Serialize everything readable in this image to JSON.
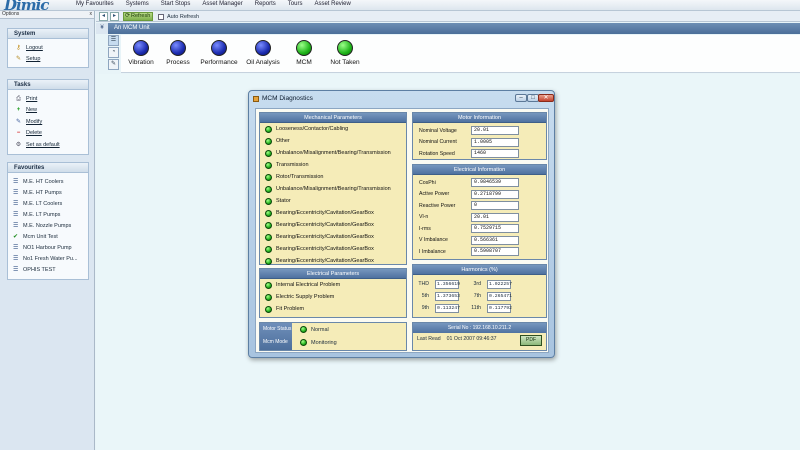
{
  "app": {
    "logo_text": "Dimic"
  },
  "menu": [
    "My Favourites",
    "Systems",
    "Start Stops",
    "Asset Manager",
    "Reports",
    "Tours",
    "Asset Review"
  ],
  "left_panel": {
    "options_label": "Options",
    "close_glyph": "x",
    "system": {
      "title": "System",
      "items": [
        {
          "label": "Logout",
          "icon": "key-icon"
        },
        {
          "label": "Setup",
          "icon": "wrench-icon"
        }
      ]
    },
    "tasks": {
      "title": "Tasks",
      "items": [
        {
          "label": "Print",
          "icon": "printer-icon"
        },
        {
          "label": "New",
          "icon": "plus-icon"
        },
        {
          "label": "Modify",
          "icon": "pencil-icon"
        },
        {
          "label": "Delete",
          "icon": "delete-icon"
        },
        {
          "label": "Set as default",
          "icon": "settings-icon"
        }
      ]
    },
    "favourites": {
      "title": "Favourites",
      "items": [
        "M.E. HT Coolers",
        "M.E. HT Pumps",
        "M.E. LT Coolers",
        "M.E. LT Pumps",
        "M.E. Nozzle Pumps",
        "Mcm Unit Test",
        "NO1 Harbour Pump",
        "No1 Fresh Water Pu...",
        "OPHIS TEST"
      ]
    }
  },
  "toolbar": {
    "refresh_label": "Refresh",
    "auto_refresh_label": "Auto Refresh",
    "auto_refresh_checked": false
  },
  "unit": {
    "title": "An MCM Unit",
    "collapse_glyph": "¥"
  },
  "status_indicators": [
    {
      "label": "Vibration",
      "color": "blue"
    },
    {
      "label": "Process",
      "color": "blue"
    },
    {
      "label": "Performance",
      "color": "blue"
    },
    {
      "label": "Oil Analysis",
      "color": "blue"
    },
    {
      "label": "MCM",
      "color": "green"
    },
    {
      "label": "Not Taken",
      "color": "green"
    }
  ],
  "dialog": {
    "title": "MCM Diagnostics",
    "mechanical": {
      "title": "Mechanical Parameters",
      "items": [
        "Looseness/Contactor/Cabling",
        "Other",
        "Unbalance/Misalignment/Bearing/Transmission",
        "Transmission",
        "Rotor/Transmission",
        "Unbalance/Misalignment/Bearing/Transmission",
        "Stator",
        "Bearing/Eccentricity/Cavitation/GearBox",
        "Bearing/Eccentricity/Cavitation/GearBox",
        "Bearing/Eccentricity/Cavitation/GearBox",
        "Bearing/Eccentricity/Cavitation/GearBox",
        "Bearing/Eccentricity/Cavitation/GearBox"
      ]
    },
    "electrical_params": {
      "title": "Electrical Parameters",
      "items": [
        "Internal Electrical Problem",
        "Electric Supply Problem",
        "Fit Problem"
      ]
    },
    "motor_info": {
      "title": "Motor Information",
      "rows": [
        {
          "label": "Nominal Voltage",
          "value": "20.01"
        },
        {
          "label": "Nominal Current",
          "value": "1.0005"
        },
        {
          "label": "Rotation Speed",
          "value": "1460"
        }
      ]
    },
    "electrical_info": {
      "title": "Electrical Information",
      "rows": [
        {
          "label": "CosPhi",
          "value": "0.9846539"
        },
        {
          "label": "Active Power",
          "value": "0.2718799"
        },
        {
          "label": "Reactive Power",
          "value": "0"
        },
        {
          "label": "Vl-n",
          "value": "20.01"
        },
        {
          "label": "I-rms",
          "value": "0.7529715"
        },
        {
          "label": "V Imbalance",
          "value": "0.566361"
        },
        {
          "label": "I Imbalance",
          "value": "0.5908707"
        }
      ]
    },
    "harmonics": {
      "title": "Harmonics (%)",
      "rows": [
        {
          "k1": "THD",
          "v1": "1.356619",
          "k2": "3rd",
          "v2": "1.022257"
        },
        {
          "k1": "5th",
          "v1": "1.373653",
          "k2": "7th",
          "v2": "0.265471"
        },
        {
          "k1": "9th",
          "v1": "0.113247",
          "k2": "11th",
          "v2": "0.117792"
        }
      ]
    },
    "motor_status": {
      "label": "Motor Status",
      "value": "Normal"
    },
    "mcm_mode": {
      "label": "Mcm Mode",
      "value": "Monitoring"
    },
    "serial": {
      "title": "Serial No : 192.168.10.211.2",
      "last_read_label": "Last Read",
      "last_read_value": "01 Oct 2007 09:46:37",
      "pdf_label": "PDF"
    }
  },
  "colors": {
    "accent": "#4f72a0",
    "panel_bg": "#f5ecb8",
    "led_green": "#25b520",
    "led_blue": "#1c2cb0"
  }
}
